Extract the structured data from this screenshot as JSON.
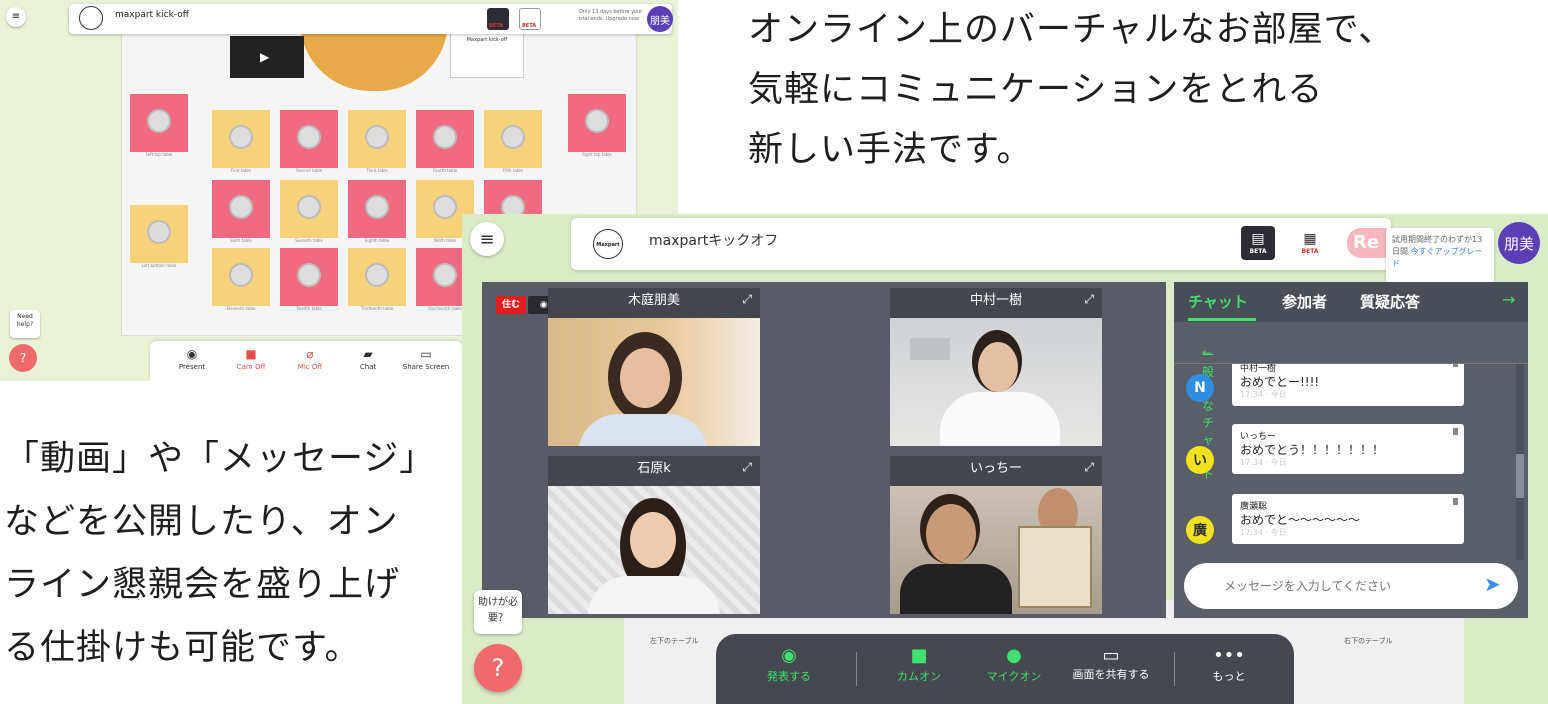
{
  "marketing": {
    "top_lines": [
      "オンライン上のバーチャルなお部屋で、",
      "気軽にコミュニケーションをとれる",
      "新しい手法です。"
    ],
    "bottom_lines": [
      "「動画」や「メッセージ」",
      "などを公開したり、オン",
      "ライン懇親会を盛り上げ",
      "る仕掛けも可能です。"
    ]
  },
  "shot_small": {
    "menu_icon": "≡",
    "room_title": "maxpart kick-off",
    "beta1": "BETA",
    "beta2": "BETA",
    "trial_text": "Only 13 days before your trial ends. Upgrade now",
    "avatar": "朋美",
    "paper_title": "Maxpart kick-off",
    "tables": [
      {
        "label": "Left top table"
      },
      {
        "label": "First table"
      },
      {
        "label": "Second table"
      },
      {
        "label": "Third table"
      },
      {
        "label": "Fourth table"
      },
      {
        "label": "Fifth table"
      },
      {
        "label": "Right top table"
      },
      {
        "label": "Left bottom table"
      },
      {
        "label": "Sixth table"
      },
      {
        "label": "Seventh table"
      },
      {
        "label": "Eighth table"
      },
      {
        "label": "Ninth table"
      },
      {
        "label": "Tenth table"
      },
      {
        "label": "Eleventh table"
      },
      {
        "label": "Twelfth table"
      },
      {
        "label": "Thirteenth table"
      },
      {
        "label": "Fourteenth table"
      }
    ],
    "help_text": "Need help?",
    "toolbar": {
      "present": "Present",
      "cam": "Cam Off",
      "mic": "Mic Off",
      "chat": "Chat",
      "share": "Share Screen"
    }
  },
  "shot_large": {
    "menu_icon": "≡",
    "logo_text": "Maxpart",
    "room_title": "maxpartキックオフ",
    "beta1": "BETA",
    "beta2": "BETA",
    "re_badge": "Re",
    "trial_text": "試用期間終了のわずか13日間",
    "trial_link": "今すぐアップグレード",
    "avatar": "朋美",
    "live_badge": "住む",
    "viewer_count": "6",
    "participants": [
      {
        "name": "木庭朋美"
      },
      {
        "name": "中村一樹"
      },
      {
        "name": "石原k"
      },
      {
        "name": "いっちー"
      }
    ],
    "chat": {
      "tabs": [
        "チャット",
        "参加者",
        "質疑応答"
      ],
      "channel": "一般的なチャット",
      "messages": [
        {
          "initial": "N",
          "author": "中村一樹",
          "text": "おめでとー!!!!",
          "time": "17:34 · 今日"
        },
        {
          "initial": "い",
          "author": "いっちー",
          "text": "おめでとう！！！！！！！",
          "time": "17:34 · 今日"
        },
        {
          "initial": "廣",
          "author": "廣瀬聡",
          "text": "おめでと〜〜〜〜〜〜",
          "time": "17:34 · 今日"
        }
      ],
      "input_placeholder": "メッセージを入力してください"
    },
    "help_text": "助けが必要？",
    "toolbar": {
      "present": "発表する",
      "cam": "カムオン",
      "mic": "マイクオン",
      "share": "画面を共有する",
      "more": "もっと"
    },
    "floor_labels": [
      "左下のテーブル",
      "右下のテーブル"
    ]
  },
  "colors": {
    "accent_green": "#3fe06d",
    "avatar_purple": "#5a3fb5",
    "help_red": "#ef6b6b",
    "live_red": "#e31d1d",
    "table_pink": "#f06a82",
    "table_yellow": "#f7d27a"
  }
}
